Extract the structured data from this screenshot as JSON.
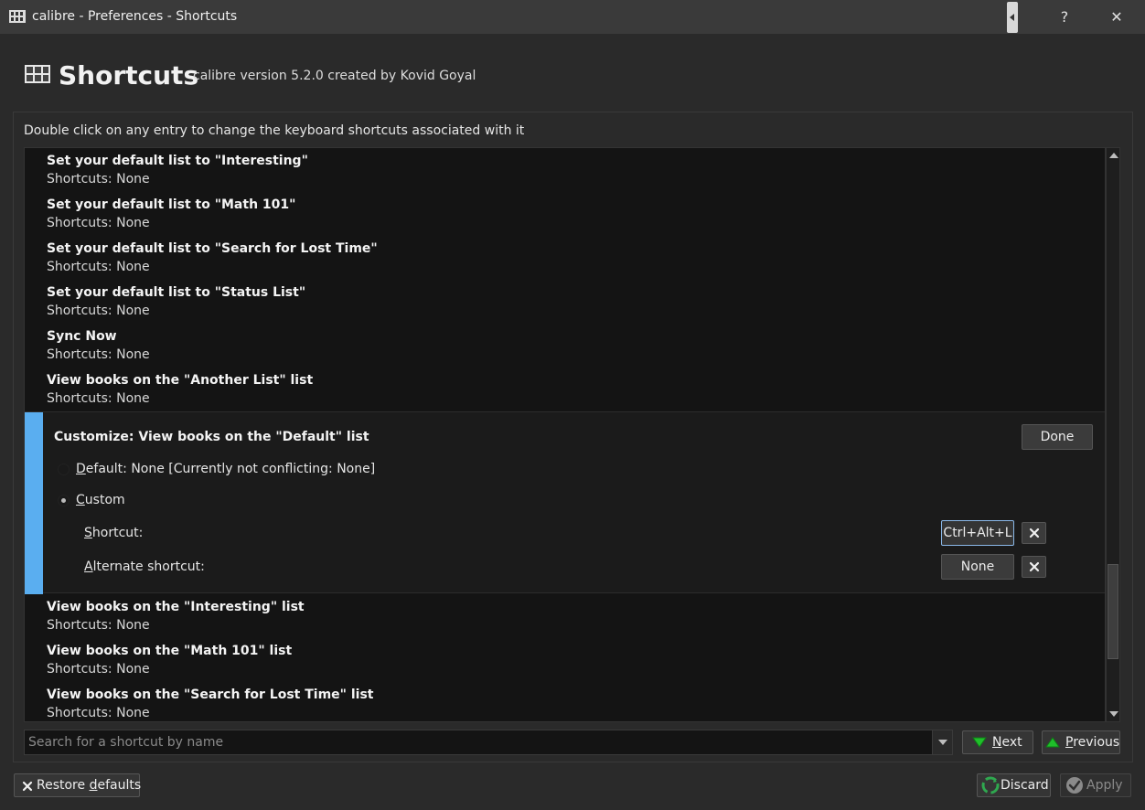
{
  "window": {
    "title": "calibre - Preferences - Shortcuts",
    "help_label": "?",
    "close_label": "✕"
  },
  "header": {
    "title": "Shortcuts",
    "subtitle": "calibre version 5.2.0 created by Kovid Goyal"
  },
  "hint": "Double click on any entry to change the keyboard shortcuts associated with it",
  "entries_above": [
    {
      "title": "Set your default list to \"Interesting\"",
      "shortcuts": "Shortcuts: None"
    },
    {
      "title": "Set your default list to \"Math 101\"",
      "shortcuts": "Shortcuts: None"
    },
    {
      "title": "Set your default list to \"Search for Lost Time\"",
      "shortcuts": "Shortcuts: None"
    },
    {
      "title": "Set your default list to \"Status List\"",
      "shortcuts": "Shortcuts: None"
    },
    {
      "title": "Sync Now",
      "shortcuts": "Shortcuts: None"
    },
    {
      "title": "View books on the \"Another List\" list",
      "shortcuts": "Shortcuts: None"
    }
  ],
  "editor": {
    "title": "Customize: View books on the \"Default\" list",
    "done_label": "Done",
    "default_option": {
      "prefix": "D",
      "rest": "efault: None [Currently not conflicting: None]",
      "checked": false
    },
    "custom_option": {
      "prefix": "C",
      "rest": "ustom",
      "checked": true
    },
    "shortcut_label": {
      "prefix": "S",
      "rest": "hortcut:"
    },
    "shortcut_value": "Ctrl+Alt+L",
    "alternate_label": {
      "prefix": "A",
      "rest": "lternate shortcut:"
    },
    "alternate_value": "None"
  },
  "entries_below": [
    {
      "title": "View books on the \"Interesting\" list",
      "shortcuts": "Shortcuts: None"
    },
    {
      "title": "View books on the \"Math 101\" list",
      "shortcuts": "Shortcuts: None"
    },
    {
      "title": "View books on the \"Search for Lost Time\" list",
      "shortcuts": "Shortcuts: None"
    }
  ],
  "search": {
    "placeholder": "Search for a shortcut by name",
    "value": ""
  },
  "nav": {
    "next_prefix": "N",
    "next_rest": "ext",
    "prev_prefix": "P",
    "prev_rest": "revious"
  },
  "footer": {
    "restore_main": "Restore ",
    "restore_u": "d",
    "restore_rest": "efaults",
    "discard_label": "Discard",
    "apply_label": "Apply"
  },
  "colors": {
    "accent": "#5aaef0",
    "background": "#2a2a2a",
    "list_background": "#141414",
    "nav_arrow": "#1fbf2a"
  }
}
